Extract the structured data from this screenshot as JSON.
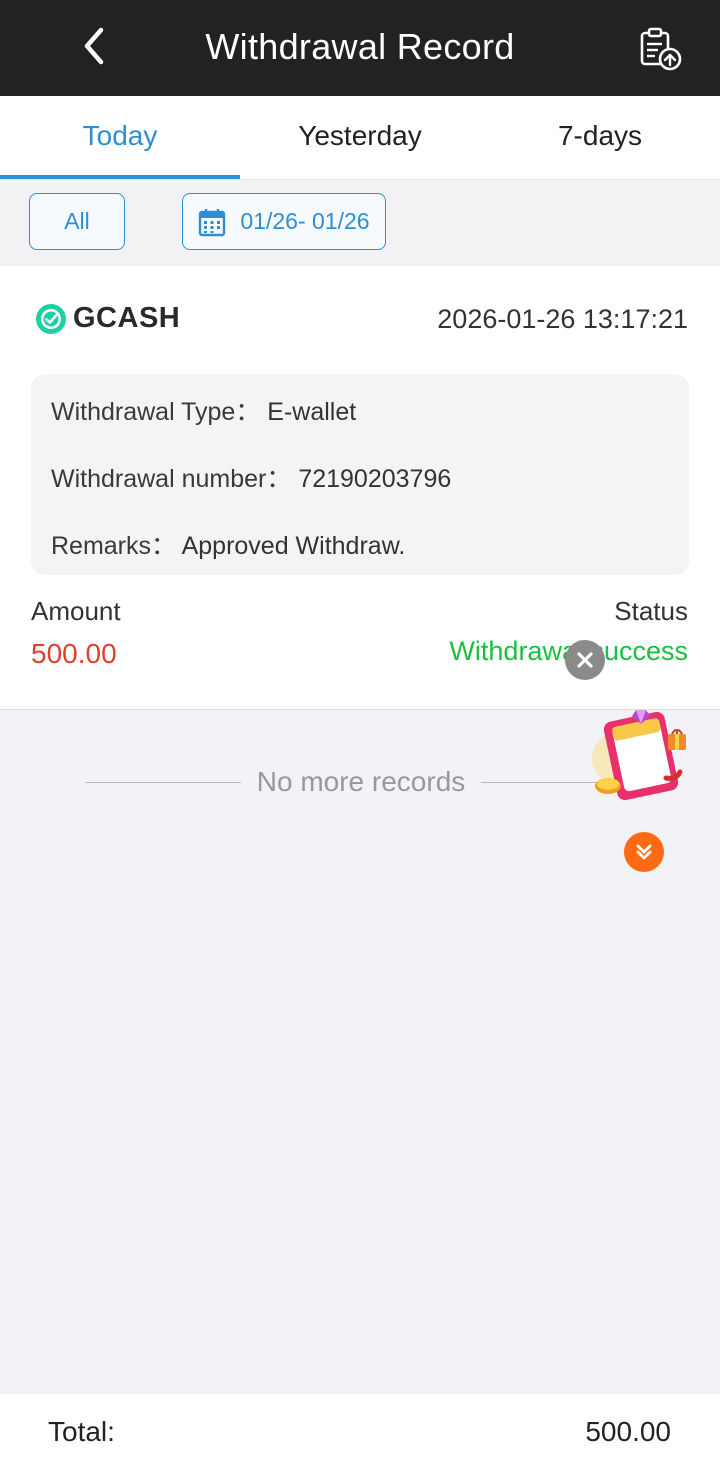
{
  "header": {
    "title": "Withdrawal Record",
    "back_icon": "chevron-left-icon",
    "export_icon": "clipboard-upload-icon"
  },
  "tabs": [
    {
      "label": "Today",
      "active": true
    },
    {
      "label": "Yesterday",
      "active": false
    },
    {
      "label": "7-days",
      "active": false
    }
  ],
  "filters": {
    "all_label": "All",
    "date_range": "01/26- 01/26",
    "calendar_icon": "calendar-icon"
  },
  "record": {
    "brand": "GCASH",
    "datetime": "2026-01-26 13:17:21",
    "type_label": "Withdrawal Type：",
    "type_value": "E-wallet",
    "number_label": "Withdrawal number：",
    "number_value": "72190203796",
    "remarks_label": "Remarks：",
    "remarks_value": "Approved Withdraw.",
    "amount_label": "Amount",
    "amount_value": "500.00",
    "status_label": "Status",
    "status_value": "Withdrawal success"
  },
  "list_end": "No more records",
  "footer": {
    "total_label": "Total:",
    "total_value": "500.00"
  },
  "colors": {
    "accent": "#2b8fd6",
    "amount": "#e0402e",
    "success": "#19bf3d",
    "header_bg": "#222222"
  }
}
